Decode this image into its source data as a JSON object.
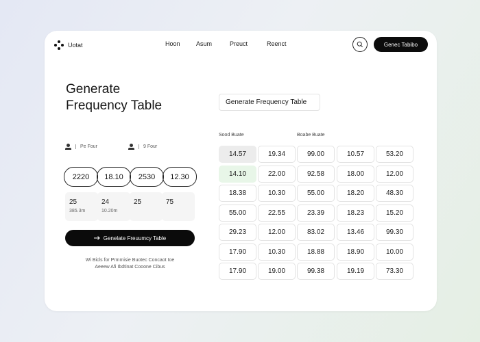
{
  "brand": {
    "name": "Uotat"
  },
  "nav": [
    "Hoon",
    "Asum",
    "Preuct",
    "Reenct"
  ],
  "header": {
    "cta_label": "Genec Tabibo",
    "search_icon": "search-icon"
  },
  "hero": {
    "line1": "Generate",
    "line2": "Frequency Table"
  },
  "generate_box": {
    "label": "Generate Frequency Table"
  },
  "inputs": {
    "label_left": "Pe Four",
    "label_right": "9 Four",
    "pills": [
      "2220",
      "18.10",
      "2530",
      "12.30"
    ],
    "stats": [
      {
        "value": "25",
        "sub": "385.3m"
      },
      {
        "value": "24",
        "sub": "10.20m"
      },
      {
        "value": "25",
        "sub": ""
      },
      {
        "value": "75",
        "sub": ""
      }
    ]
  },
  "action": {
    "label": "Genelate Freuumcy Table",
    "icon": "arrow-right-icon"
  },
  "footer": {
    "line1": "Wi Bicls for Prmmisie Buotec Concaot Ioe",
    "line2": "Aeeew Afi Ibdtinat Cooone Cibus"
  },
  "table": {
    "header_left": "Sood Buate",
    "header_right": "Boabe Buate",
    "rows": [
      [
        "14.57",
        "19.34",
        "99.00",
        "10.57",
        "53.20"
      ],
      [
        "14.10",
        "22.00",
        "92.58",
        "18.00",
        "12.00"
      ],
      [
        "18.38",
        "10.30",
        "55.00",
        "18.20",
        "48.30"
      ],
      [
        "55.00",
        "22.55",
        "23.39",
        "18.23",
        "15.20"
      ],
      [
        "29.23",
        "12.00",
        "83.02",
        "13.46",
        "99.30"
      ],
      [
        "17.90",
        "10.30",
        "18.88",
        "18.90",
        "10.00"
      ],
      [
        "17.90",
        "19.00",
        "99.38",
        "19.19",
        "73.30"
      ]
    ],
    "highlight_colors": {
      "gray": "#ececec",
      "green": "#e8f6e8"
    }
  }
}
